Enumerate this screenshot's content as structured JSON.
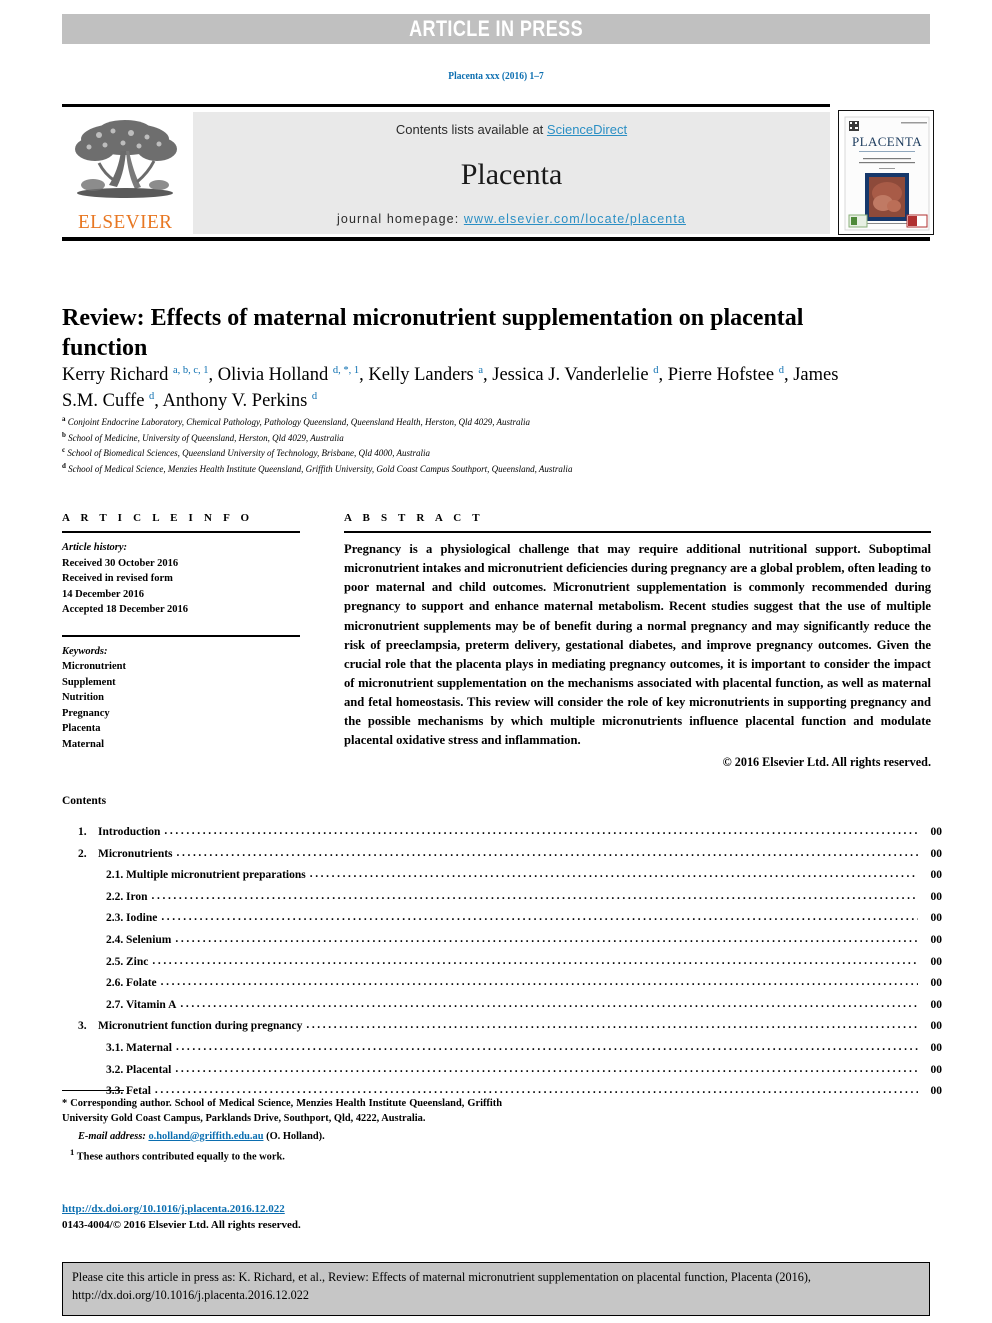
{
  "banner": {
    "text": "ARTICLE IN PRESS"
  },
  "running_head": "Placenta xxx (2016) 1–7",
  "masthead": {
    "contents_prefix": "Contents lists available at ",
    "sciencedirect": "ScienceDirect",
    "journal_name": "Placenta",
    "homepage_prefix": "journal homepage: ",
    "homepage_url": "www.elsevier.com/locate/placenta",
    "publisher": "ELSEVIER",
    "cover_title": "PLACENTA",
    "accent_blue": "#2b8fc4",
    "elsevier_orange": "#e87722"
  },
  "article": {
    "title": "Review: Effects of maternal micronutrient supplementation on placental function",
    "authors": [
      {
        "name": "Kerry Richard",
        "sup": "a, b, c, 1"
      },
      {
        "name": "Olivia Holland",
        "sup": "d, *, 1"
      },
      {
        "name": "Kelly Landers",
        "sup": "a"
      },
      {
        "name": "Jessica J. Vanderlelie",
        "sup": "d"
      },
      {
        "name": "Pierre Hofstee",
        "sup": "d"
      },
      {
        "name": "James S.M. Cuffe",
        "sup": "d"
      },
      {
        "name": "Anthony V. Perkins",
        "sup": "d"
      }
    ],
    "affiliations": [
      {
        "marker": "a",
        "text": "Conjoint Endocrine Laboratory, Chemical Pathology, Pathology Queensland, Queensland Health, Herston, Qld 4029, Australia"
      },
      {
        "marker": "b",
        "text": "School of Medicine, University of Queensland, Herston, Qld 4029, Australia"
      },
      {
        "marker": "c",
        "text": "School of Biomedical Sciences, Queensland University of Technology, Brisbane, Qld 4000, Australia"
      },
      {
        "marker": "d",
        "text": "School of Medical Science, Menzies Health Institute Queensland, Griffith University, Gold Coast Campus Southport, Queensland, Australia"
      }
    ]
  },
  "article_info": {
    "heading": "A R T I C L E   I N F O",
    "history_label": "Article history:",
    "history": [
      "Received 30 October 2016",
      "Received in revised form",
      "14 December 2016",
      "Accepted 18 December 2016"
    ],
    "keywords_label": "Keywords:",
    "keywords": [
      "Micronutrient",
      "Supplement",
      "Nutrition",
      "Pregnancy",
      "Placenta",
      "Maternal"
    ]
  },
  "abstract": {
    "heading": "A B S T R A C T",
    "body": "Pregnancy is a physiological challenge that may require additional nutritional support. Suboptimal micronutrient intakes and micronutrient deficiencies during pregnancy are a global problem, often leading to poor maternal and child outcomes. Micronutrient supplementation is commonly recommended during pregnancy to support and enhance maternal metabolism. Recent studies suggest that the use of multiple micronutrient supplements may be of benefit during a normal pregnancy and may significantly reduce the risk of preeclampsia, preterm delivery, gestational diabetes, and improve pregnancy outcomes. Given the crucial role that the placenta plays in mediating pregnancy outcomes, it is important to consider the impact of micronutrient supplementation on the mechanisms associated with placental function, as well as maternal and fetal homeostasis. This review will consider the role of key micronutrients in supporting pregnancy and the possible mechanisms by which multiple micronutrients influence placental function and modulate placental oxidative stress and inflammation.",
    "copyright": "© 2016 Elsevier Ltd. All rights reserved."
  },
  "contents": {
    "heading": "Contents",
    "entries": [
      {
        "num": "1.",
        "label": "Introduction",
        "page": "00",
        "level": 1
      },
      {
        "num": "2.",
        "label": "Micronutrients",
        "page": "00",
        "level": 1
      },
      {
        "num": "2.1.",
        "label": "Multiple micronutrient preparations",
        "page": "00",
        "level": 2
      },
      {
        "num": "2.2.",
        "label": "Iron",
        "page": "00",
        "level": 2
      },
      {
        "num": "2.3.",
        "label": "Iodine",
        "page": "00",
        "level": 2
      },
      {
        "num": "2.4.",
        "label": "Selenium",
        "page": "00",
        "level": 2
      },
      {
        "num": "2.5.",
        "label": "Zinc",
        "page": "00",
        "level": 2
      },
      {
        "num": "2.6.",
        "label": "Folate",
        "page": "00",
        "level": 2
      },
      {
        "num": "2.7.",
        "label": "Vitamin A",
        "page": "00",
        "level": 2
      },
      {
        "num": "3.",
        "label": "Micronutrient function during pregnancy",
        "page": "00",
        "level": 1
      },
      {
        "num": "3.1.",
        "label": "Maternal",
        "page": "00",
        "level": 2
      },
      {
        "num": "3.2.",
        "label": "Placental",
        "page": "00",
        "level": 2
      },
      {
        "num": "3.3.",
        "label": "Fetal",
        "page": "00",
        "level": 2
      }
    ]
  },
  "footnotes": {
    "corresponding": "* Corresponding author. School of Medical Science, Menzies Health Institute Queensland, Griffith University Gold Coast Campus, Parklands Drive, Southport, Qld, 4222, Australia.",
    "email_label": "E-mail address:",
    "email": "o.holland@griffith.edu.au",
    "email_owner": "(O. Holland).",
    "equal_marker": "1",
    "equal_contrib": "These authors contributed equally to the work.",
    "doi": "http://dx.doi.org/10.1016/j.placenta.2016.12.022",
    "issn_line": "0143-4004/© 2016 Elsevier Ltd. All rights reserved."
  },
  "cite_box": {
    "text": "Please cite this article in press as: K. Richard, et al., Review: Effects of maternal micronutrient supplementation on placental function, Placenta (2016), http://dx.doi.org/10.1016/j.placenta.2016.12.022"
  }
}
